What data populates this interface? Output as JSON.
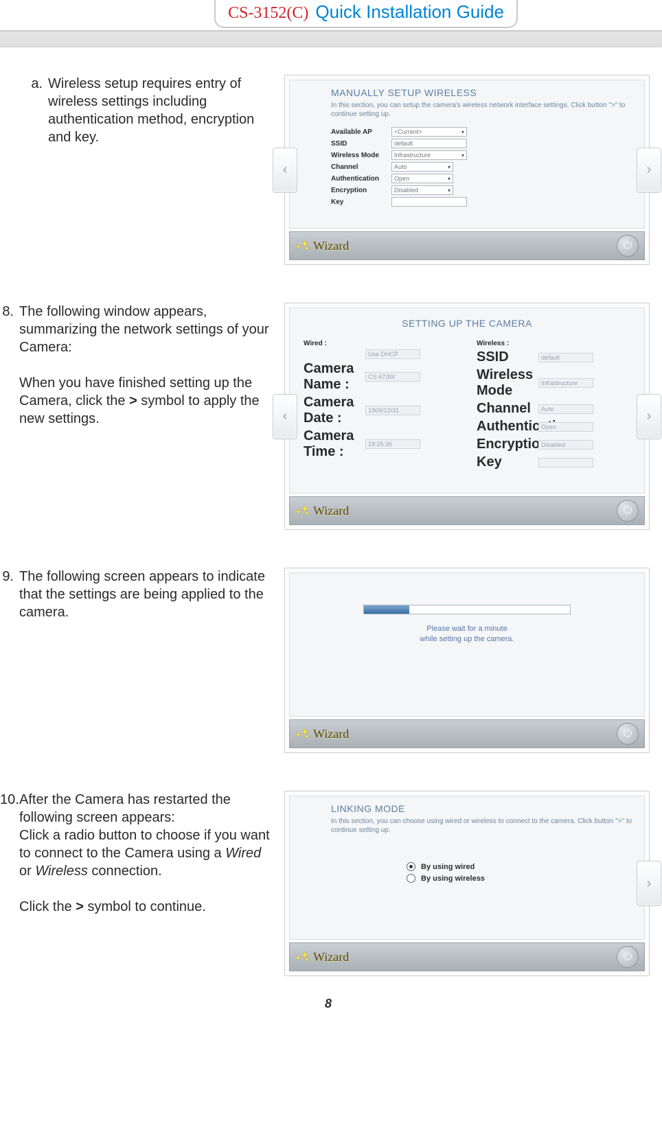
{
  "header": {
    "model": "CS-3152(C)",
    "title": "Quick Installation Guide"
  },
  "step_a": {
    "marker": "a.",
    "text": "Wireless setup requires entry of wireless settings including authentication method, encryption and key."
  },
  "panel1": {
    "title": "MANUALLY SETUP WIRELESS",
    "desc": "In this section, you can setup the camera's wireless network interface settings. Click button \">\" to continue setting up.",
    "rows": {
      "available_ap_label": "Available AP",
      "available_ap_value": "<Current>",
      "ssid_label": "SSID",
      "ssid_value": "default",
      "mode_label": "Wireless Mode",
      "mode_value": "Infrastructure",
      "channel_label": "Channel",
      "channel_value": "Auto",
      "auth_label": "Authentication",
      "auth_value": "Open",
      "enc_label": "Encryption",
      "enc_value": "Disabled",
      "key_label": "Key",
      "key_value": ""
    }
  },
  "step_8": {
    "marker": "8.",
    "p1": "The following window appears, summarizing the network settings of your Camera:",
    "p2a": "When you have finished setting up the Camera, click the ",
    "p2b": ">",
    "p2c": " symbol to apply the new settings."
  },
  "panel2": {
    "title": "SETTING UP THE CAMERA",
    "left": {
      "heading": "Wired :",
      "r1l": "",
      "r1v": "Use DHCP",
      "r2l": "Camera Name :",
      "r2v": "CS-673W",
      "r3l": "Camera Date :",
      "r3v": "1969/12/31",
      "r4l": "Camera Time :",
      "r4v": "18:25:36"
    },
    "right": {
      "heading": "Wireless :",
      "r1l": "SSID",
      "r1v": "default",
      "r2l": "Wireless Mode",
      "r2v": "Infrastructure",
      "r3l": "Channel",
      "r3v": "Auto",
      "r4l": "Authentication",
      "r4v": "Open",
      "r5l": "Encryption",
      "r5v": "Disabled",
      "r6l": "Key",
      "r6v": ""
    }
  },
  "step_9": {
    "marker": "9.",
    "text": "The following screen appears to indicate that the settings are being applied to the camera."
  },
  "panel3": {
    "line1": "Please wait for a minute",
    "line2": "while setting up the camera."
  },
  "step_10": {
    "marker": "10.",
    "l1": "After the Camera has restarted the following screen appears:",
    "l2a": "Click a radio button to choose if you want to connect to the Camera using a ",
    "l2b": "Wired",
    "l2c": " or ",
    "l2d": "Wireless",
    "l2e": " connection.",
    "l3a": "Click the ",
    "l3b": ">",
    "l3c": " symbol to continue."
  },
  "panel4": {
    "title": "LINKING MODE",
    "desc": "In this section, you can choose using wired or wireless to connect to the camera. Click button \">\" to continue setting up.",
    "opt1": "By using wired",
    "opt2": "By using wireless"
  },
  "wizard_label": "Wizard",
  "page_number": "8",
  "glyphs": {
    "left": "‹",
    "right": "›",
    "power": "⏻",
    "dd": "▾"
  }
}
